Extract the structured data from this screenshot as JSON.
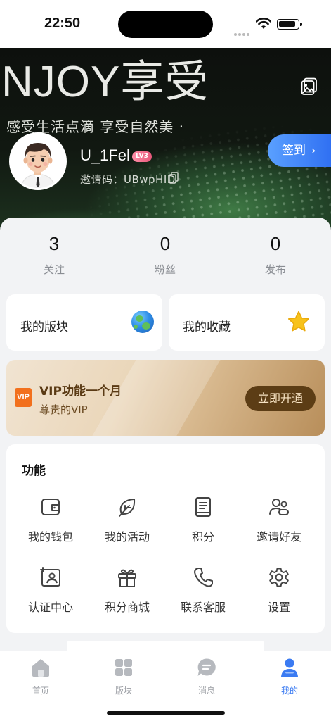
{
  "status_bar": {
    "time": "22:50"
  },
  "hero": {
    "enjoy_text": "NJOY享受",
    "slogan": "感受生活点滴 享受自然美 ·",
    "username": "U_1Fel",
    "level_badge": "LV3",
    "invite_code": "邀请码：UBwpHID",
    "signin_label": "签到",
    "signin_arrow": "›"
  },
  "stats": [
    {
      "value": "3",
      "label": "关注"
    },
    {
      "value": "0",
      "label": "粉丝"
    },
    {
      "value": "0",
      "label": "发布"
    }
  ],
  "quick_cards": {
    "my_sections": "我的版块",
    "my_favorites": "我的收藏"
  },
  "vip": {
    "logo_text": "VIP",
    "title": "VIP功能一个月",
    "subtitle": "尊贵的VIP",
    "button": "立即开通"
  },
  "functions": {
    "heading": "功能",
    "items": [
      {
        "label": "我的钱包",
        "icon": "wallet-icon"
      },
      {
        "label": "我的活动",
        "icon": "leaf-icon"
      },
      {
        "label": "积分",
        "icon": "book-icon"
      },
      {
        "label": "邀请好友",
        "icon": "users-icon"
      },
      {
        "label": "认证中心",
        "icon": "id-card-icon"
      },
      {
        "label": "积分商城",
        "icon": "gift-icon"
      },
      {
        "label": "联系客服",
        "icon": "phone-icon"
      },
      {
        "label": "设置",
        "icon": "gear-icon"
      }
    ]
  },
  "tabbar": {
    "tabs": [
      {
        "label": "首页",
        "icon": "home-icon"
      },
      {
        "label": "版块",
        "icon": "grid-icon"
      },
      {
        "label": "消息",
        "icon": "chat-icon"
      },
      {
        "label": "我的",
        "icon": "person-icon",
        "active": true
      }
    ],
    "active_color": "#3b7bf2",
    "inactive_color": "#b6b9be"
  }
}
